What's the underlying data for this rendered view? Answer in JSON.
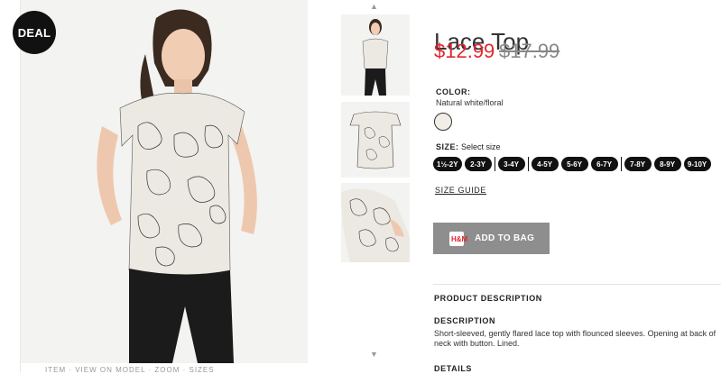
{
  "badge": "DEAL",
  "photo_caption": "ITEM · VIEW ON MODEL · ZOOM · SIZES",
  "product": {
    "title": "Lace Top",
    "price_now": "$12.99",
    "price_old": "$17.99"
  },
  "color": {
    "label": "COLOR:",
    "value": "Natural white/floral",
    "swatch_hex": "#f2ede6"
  },
  "size": {
    "label": "SIZE:",
    "hint": "Select size",
    "options": [
      "1½-2Y",
      "2-3Y",
      "3-4Y",
      "4-5Y",
      "5-6Y",
      "6-7Y",
      "7-8Y",
      "8-9Y",
      "9-10Y"
    ]
  },
  "size_guide": "SIZE GUIDE",
  "add_to_bag": {
    "label": "ADD TO BAG",
    "icon_text": "H&M",
    "color": "#8e8e8e"
  },
  "product_description": {
    "heading": "PRODUCT DESCRIPTION",
    "description_heading": "DESCRIPTION",
    "description_text": "Short-sleeved, gently flared lace top with flounced sleeves. Opening at back of neck with button. Lined.",
    "details_heading": "DETAILS"
  },
  "colors": {
    "price_red": "#e0262f",
    "badge_black": "#111111"
  }
}
